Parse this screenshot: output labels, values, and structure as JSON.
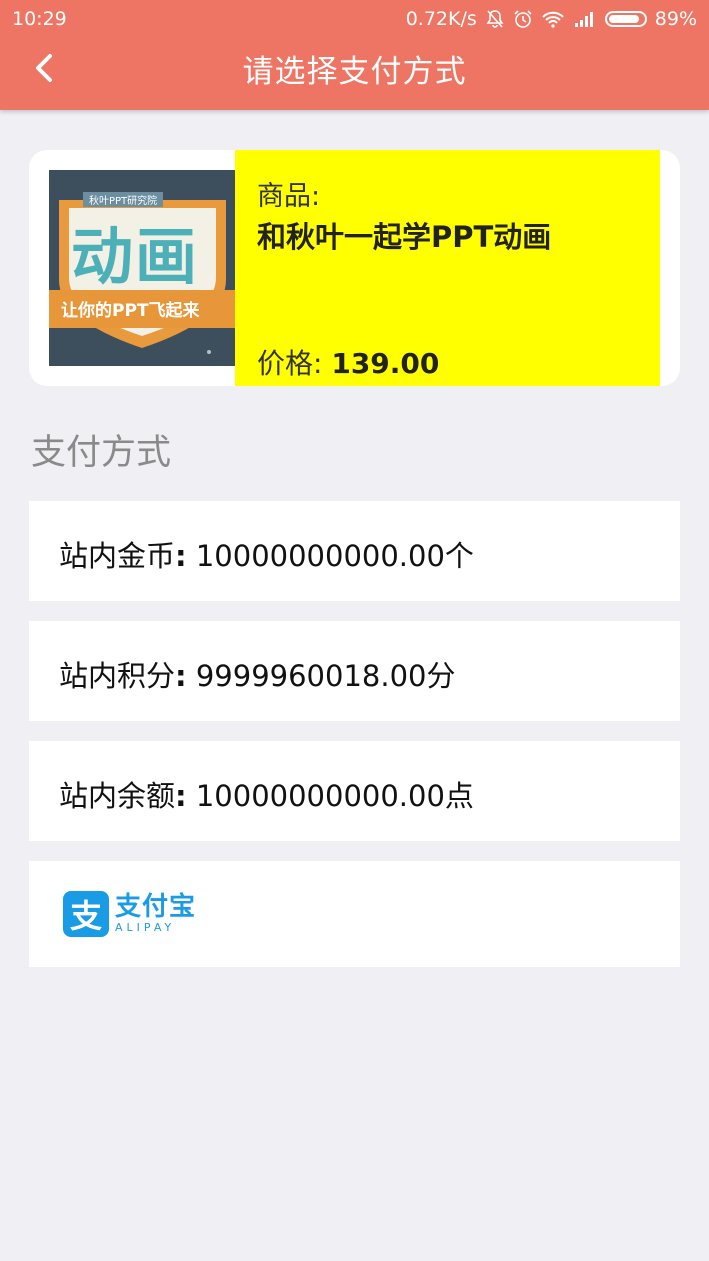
{
  "status_bar": {
    "time": "10:29",
    "network_speed": "0.72K/s",
    "battery": "89%",
    "icons": [
      "mute-icon",
      "alarm-icon",
      "wifi-icon",
      "signal-icon",
      "battery-icon"
    ]
  },
  "header": {
    "title": "请选择支付方式",
    "back_icon": "chevron-left-icon",
    "color": "#ee7563"
  },
  "product": {
    "label": "商品:",
    "name": "和秋叶一起学PPT动画",
    "price_label": "价格:",
    "price": "139.00",
    "thumbnail": {
      "header": "秋叶PPT研究院",
      "title": "动画",
      "banner": "让你的PPT飞起来"
    },
    "highlight_color": "#ffff00"
  },
  "payment": {
    "section_title": "支付方式",
    "options": [
      {
        "label": "站内金币",
        "value": "10000000000.00个"
      },
      {
        "label": "站内积分",
        "value": "9999960018.00分"
      },
      {
        "label": "站内余额",
        "value": "10000000000.00点"
      }
    ],
    "alipay": {
      "mark": "支",
      "name": "支付宝",
      "name_en": "ALIPAY",
      "color": "#1a9be6"
    }
  }
}
